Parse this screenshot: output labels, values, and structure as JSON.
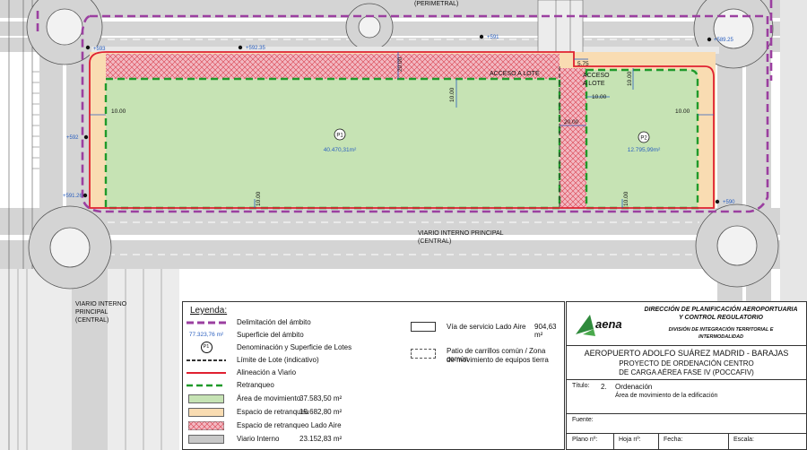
{
  "plan": {
    "road_labels": {
      "perimetral": "(PERIMETRAL)",
      "central_top_1": "VIARIO INTERNO PRINCIPAL",
      "central_top_2": "(CENTRAL)",
      "central_left_1": "VIARIO INTERNO",
      "central_left_2": "PRINCIPAL",
      "central_left_3": "(CENTRAL)"
    },
    "elevations": [
      "+593",
      "+592.35",
      "+591",
      "+589.25",
      "+592",
      "+591.26",
      "+590"
    ],
    "access_labels": [
      "ACCESO A LOTE",
      "ACCESO",
      "A LOTE"
    ],
    "dimensions": {
      "d1": "10.00",
      "d2": "20.00",
      "d3": "10.00",
      "d4": "20.00",
      "d5": "10.00",
      "d6": "10.00",
      "d7": "10.00",
      "d8": "10.00",
      "d9": "5.75",
      "d10": "10.00",
      "d11": "10.00"
    },
    "lots": [
      {
        "id": "P1",
        "area": "40.470,31m²"
      },
      {
        "id": "P2",
        "area": "12.795,99m²"
      }
    ],
    "colors": {
      "movement_area": "#c6e3b4",
      "setback_space": "#f9dcb2",
      "setback_airside": "#f2b8c2",
      "internal_road": "#c8c8c8",
      "boundary": "#9b3fa0",
      "alignment": "#e02030",
      "setback_line": "#1f9a2a"
    }
  },
  "legend": {
    "title": "Leyenda:",
    "items": [
      {
        "label": "Delimitación del ámbito"
      },
      {
        "symbol_text": "77.323,76 m²",
        "label": "Superficie del ámbito"
      },
      {
        "symbol_text": "P1",
        "label": "Denominación y Superficie de Lotes"
      },
      {
        "label": "Límite de Lote (indicativo)"
      },
      {
        "label": "Alineación a Viario"
      },
      {
        "label": "Retranqueo"
      },
      {
        "label": "Área de movimiento",
        "value": "37.583,50 m²"
      },
      {
        "label": "Espacio de retranqueo",
        "value": "15.682,80 m²"
      },
      {
        "label": "Espacio de retranqueo Lado Aire"
      },
      {
        "label": "Viario Interno",
        "value": "23.152,83 m²"
      }
    ],
    "right_items": [
      {
        "label": "Vía de servicio Lado Aire",
        "value": "904,63 m²"
      },
      {
        "label_1": "Patio de carrillos común / Zona común",
        "label_2": "de movimiento de equipos tierra"
      }
    ]
  },
  "titleblock": {
    "logo": "aena",
    "org_1": "DIRECCIÓN DE PLANIFICACIÓN AEROPORTUARIA",
    "org_2": "Y CONTROL REGULATORIO",
    "dept_1": "DIVISIÓN DE INTEGRACIÓN TERRITORIAL E",
    "dept_2": "INTERMODALIDAD",
    "airport": "AEROPUERTO ADOLFO SUÁREZ MADRID - BARAJAS",
    "project_1": "PROYECTO DE ORDENACIÓN CENTRO",
    "project_2": "DE CARGA AÉREA FASE IV (POCCAFIV)",
    "titulo_label": "Título:",
    "titulo_num": "2.",
    "titulo": "Ordenación",
    "subtitulo": "Área de movimiento de la edificación",
    "fuente_label": "Fuente:",
    "plano_label": "Plano nº:",
    "hoja_label": "Hoja nº:",
    "fecha_label": "Fecha:",
    "escala_label": "Escala:"
  }
}
